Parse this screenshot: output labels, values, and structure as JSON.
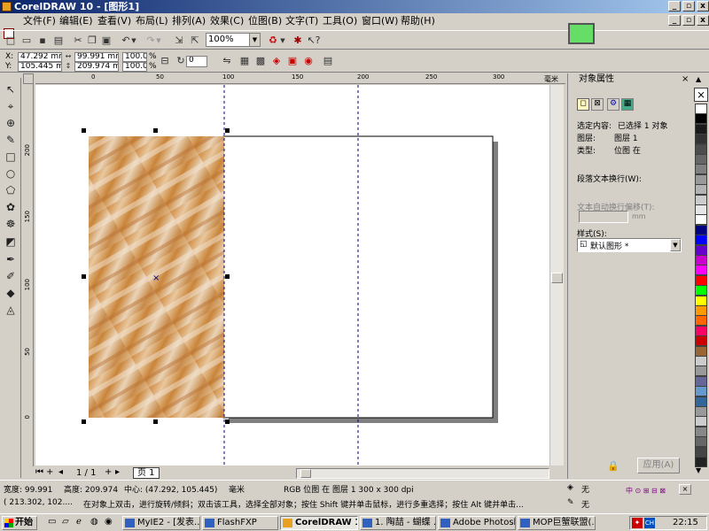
{
  "window": {
    "title": "CorelDRAW 10 - [图形1]"
  },
  "menu": [
    "文件(F)",
    "编辑(E)",
    "查看(V)",
    "布局(L)",
    "排列(A)",
    "效果(C)",
    "位图(B)",
    "文字(T)",
    "工具(O)",
    "窗口(W)",
    "帮助(H)"
  ],
  "toolbar": {
    "zoom": "100%"
  },
  "propbar": {
    "x_label": "X:",
    "y_label": "Y:",
    "x": "47.292 mm",
    "y": "105.445 mm",
    "w": "99.991 mm",
    "h": "209.974 m",
    "sx": "100.0",
    "sy": "100.0",
    "pct": "%",
    "rot": "0"
  },
  "ruler": {
    "top": [
      "0",
      "50",
      "100",
      "150",
      "200",
      "250",
      "300"
    ],
    "left": [
      "200",
      "150",
      "100",
      "50",
      "0"
    ],
    "unit": "毫米"
  },
  "page_nav": {
    "counter": "1 / 1",
    "tab": "页 1"
  },
  "docker": {
    "title": "对象属性",
    "sel_label": "选定内容:",
    "sel_value": "已选择 1 对象",
    "layer_label": "图层:",
    "layer_value": "图层 1",
    "type_label": "类型:",
    "type_value": "位图 在",
    "para_label": "段落文本换行(W):",
    "offset_label": "文本自动换行偏移(T):",
    "offset_unit": "mm",
    "style_label": "样式(S):",
    "style_value": "默认图形 *",
    "apply": "应用(A)"
  },
  "palette_colors": [
    "#ffffff",
    "#000000",
    "#1a1a1a",
    "#333333",
    "#4d4d4d",
    "#666666",
    "#808080",
    "#999999",
    "#b3b3b3",
    "#cccccc",
    "#e6e6e6",
    "#ffffff",
    "#000080",
    "#0000ff",
    "#6600cc",
    "#cc00cc",
    "#ff00ff",
    "#ff0000",
    "#00ff00",
    "#ffff00",
    "#ff9900",
    "#ff6600",
    "#ff0066",
    "#cc0000",
    "#996633",
    "#cccccc",
    "#999999",
    "#666699",
    "#6699cc",
    "#336699",
    "#999999",
    "#cccccc",
    "#888888",
    "#666666",
    "#444444",
    "#222222"
  ],
  "status": {
    "width": "宽度: 99.991",
    "height": "高度: 209.974",
    "center": "中心: (47.292, 105.445)",
    "unit": "毫米",
    "info": "RGB 位图 在 图层 1 300 x 300 dpi",
    "fill": "无",
    "outline": "无",
    "coord": "( 213.302, 102....",
    "hint": "在对象上双击，进行旋转/倾斜；双击该工具，选择全部对象；按住 Shift 键并单击鼠标，进行多重选择；按住 Alt 键并单击..."
  },
  "taskbar": {
    "start": "开始",
    "tasks": [
      "MyIE2 - [发表...",
      "FlashFXP",
      "CorelDRAW 10 ...",
      "1. 陶喆 - 蝴蝶 ...",
      "Adobe Photoshop",
      "MOP巨蟹联盟(..."
    ],
    "tray_lang": "CH",
    "clock": "22:15"
  }
}
